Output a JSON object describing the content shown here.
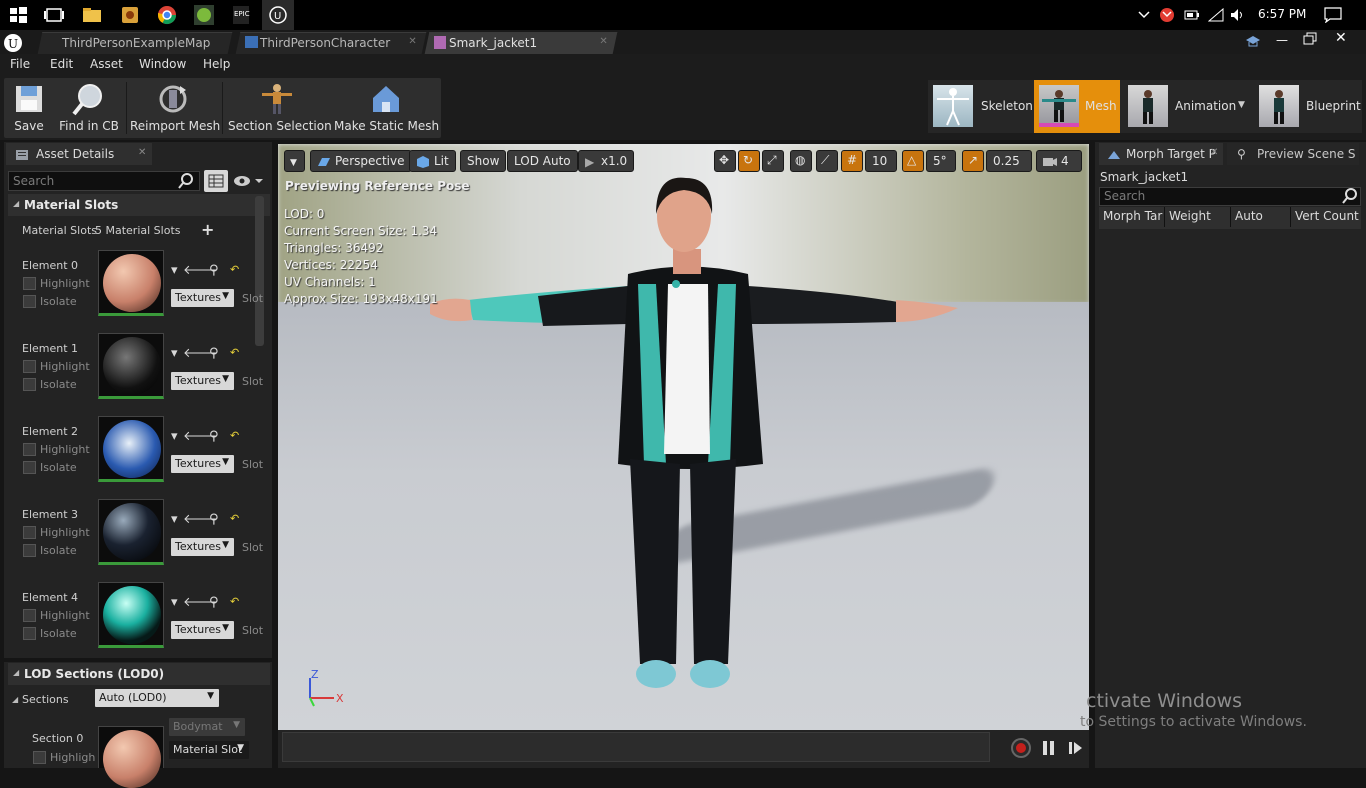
{
  "taskbar": {
    "clock": "6:57 PM",
    "app_badge": "EPIC"
  },
  "tabs": [
    {
      "label": "ThirdPersonExampleMap"
    },
    {
      "label": "ThirdPersonCharacter"
    },
    {
      "label": "Smark_jacket1"
    }
  ],
  "menu": [
    "File",
    "Edit",
    "Asset",
    "Window",
    "Help"
  ],
  "toolbar": {
    "save": "Save",
    "find_in_cb": "Find in CB",
    "reimport_mesh": "Reimport Mesh",
    "section_selection": "Section Selection",
    "make_static_mesh": "Make Static Mesh"
  },
  "modes": {
    "skeleton": "Skeleton",
    "mesh": "Mesh",
    "animation": "Animation",
    "blueprint": "Blueprint",
    "active": "Mesh"
  },
  "asset_details": {
    "tab": "Asset Details",
    "search_placeholder": "Search",
    "material_slots_header": "Material Slots",
    "material_slots_label": "Material Slots",
    "material_slots_value": "5 Material Slots",
    "elements": [
      {
        "label": "Element 0",
        "textures": "Textures",
        "slot": "Slot N"
      },
      {
        "label": "Element 1",
        "textures": "Textures",
        "slot": "Slot N"
      },
      {
        "label": "Element 2",
        "textures": "Textures",
        "slot": "Slot N"
      },
      {
        "label": "Element 3",
        "textures": "Textures",
        "slot": "Slot N"
      },
      {
        "label": "Element 4",
        "textures": "Textures",
        "slot": "Slot N"
      }
    ],
    "highlight": "Highlight",
    "isolate": "Isolate",
    "lod_header": "LOD Sections (LOD0)",
    "sections_label": "Sections",
    "sections_value": "Auto (LOD0)",
    "section0_label": "Section 0",
    "section0_mat": "Bodymat",
    "section0_slot": "Material Slot",
    "section0_highlight": "Highligh"
  },
  "viewport": {
    "perspective": "Perspective",
    "lit": "Lit",
    "show": "Show",
    "lod_auto": "LOD Auto",
    "speed": "x1.0",
    "grid_snap": "10",
    "rot_snap": "5°",
    "scale_snap": "0.25",
    "cam_speed": "4",
    "preview_note": "Previewing Reference Pose",
    "stats": [
      "LOD: 0",
      "Current Screen Size: 1.34",
      "Triangles: 36492",
      "Vertices: 22254",
      "UV Channels: 1",
      "Approx Size: 193x48x191"
    ],
    "axis_z": "Z",
    "axis_x": "X"
  },
  "right_panel": {
    "tab1": "Morph Target P",
    "tab2": "Preview Scene S",
    "asset_name": "Smark_jacket1",
    "search_placeholder": "Search",
    "columns": [
      "Morph Tar",
      "Weight",
      "Auto",
      "Vert Count"
    ]
  },
  "watermark": {
    "line1": "ctivate Windows",
    "line2": "to Settings to activate Windows."
  }
}
